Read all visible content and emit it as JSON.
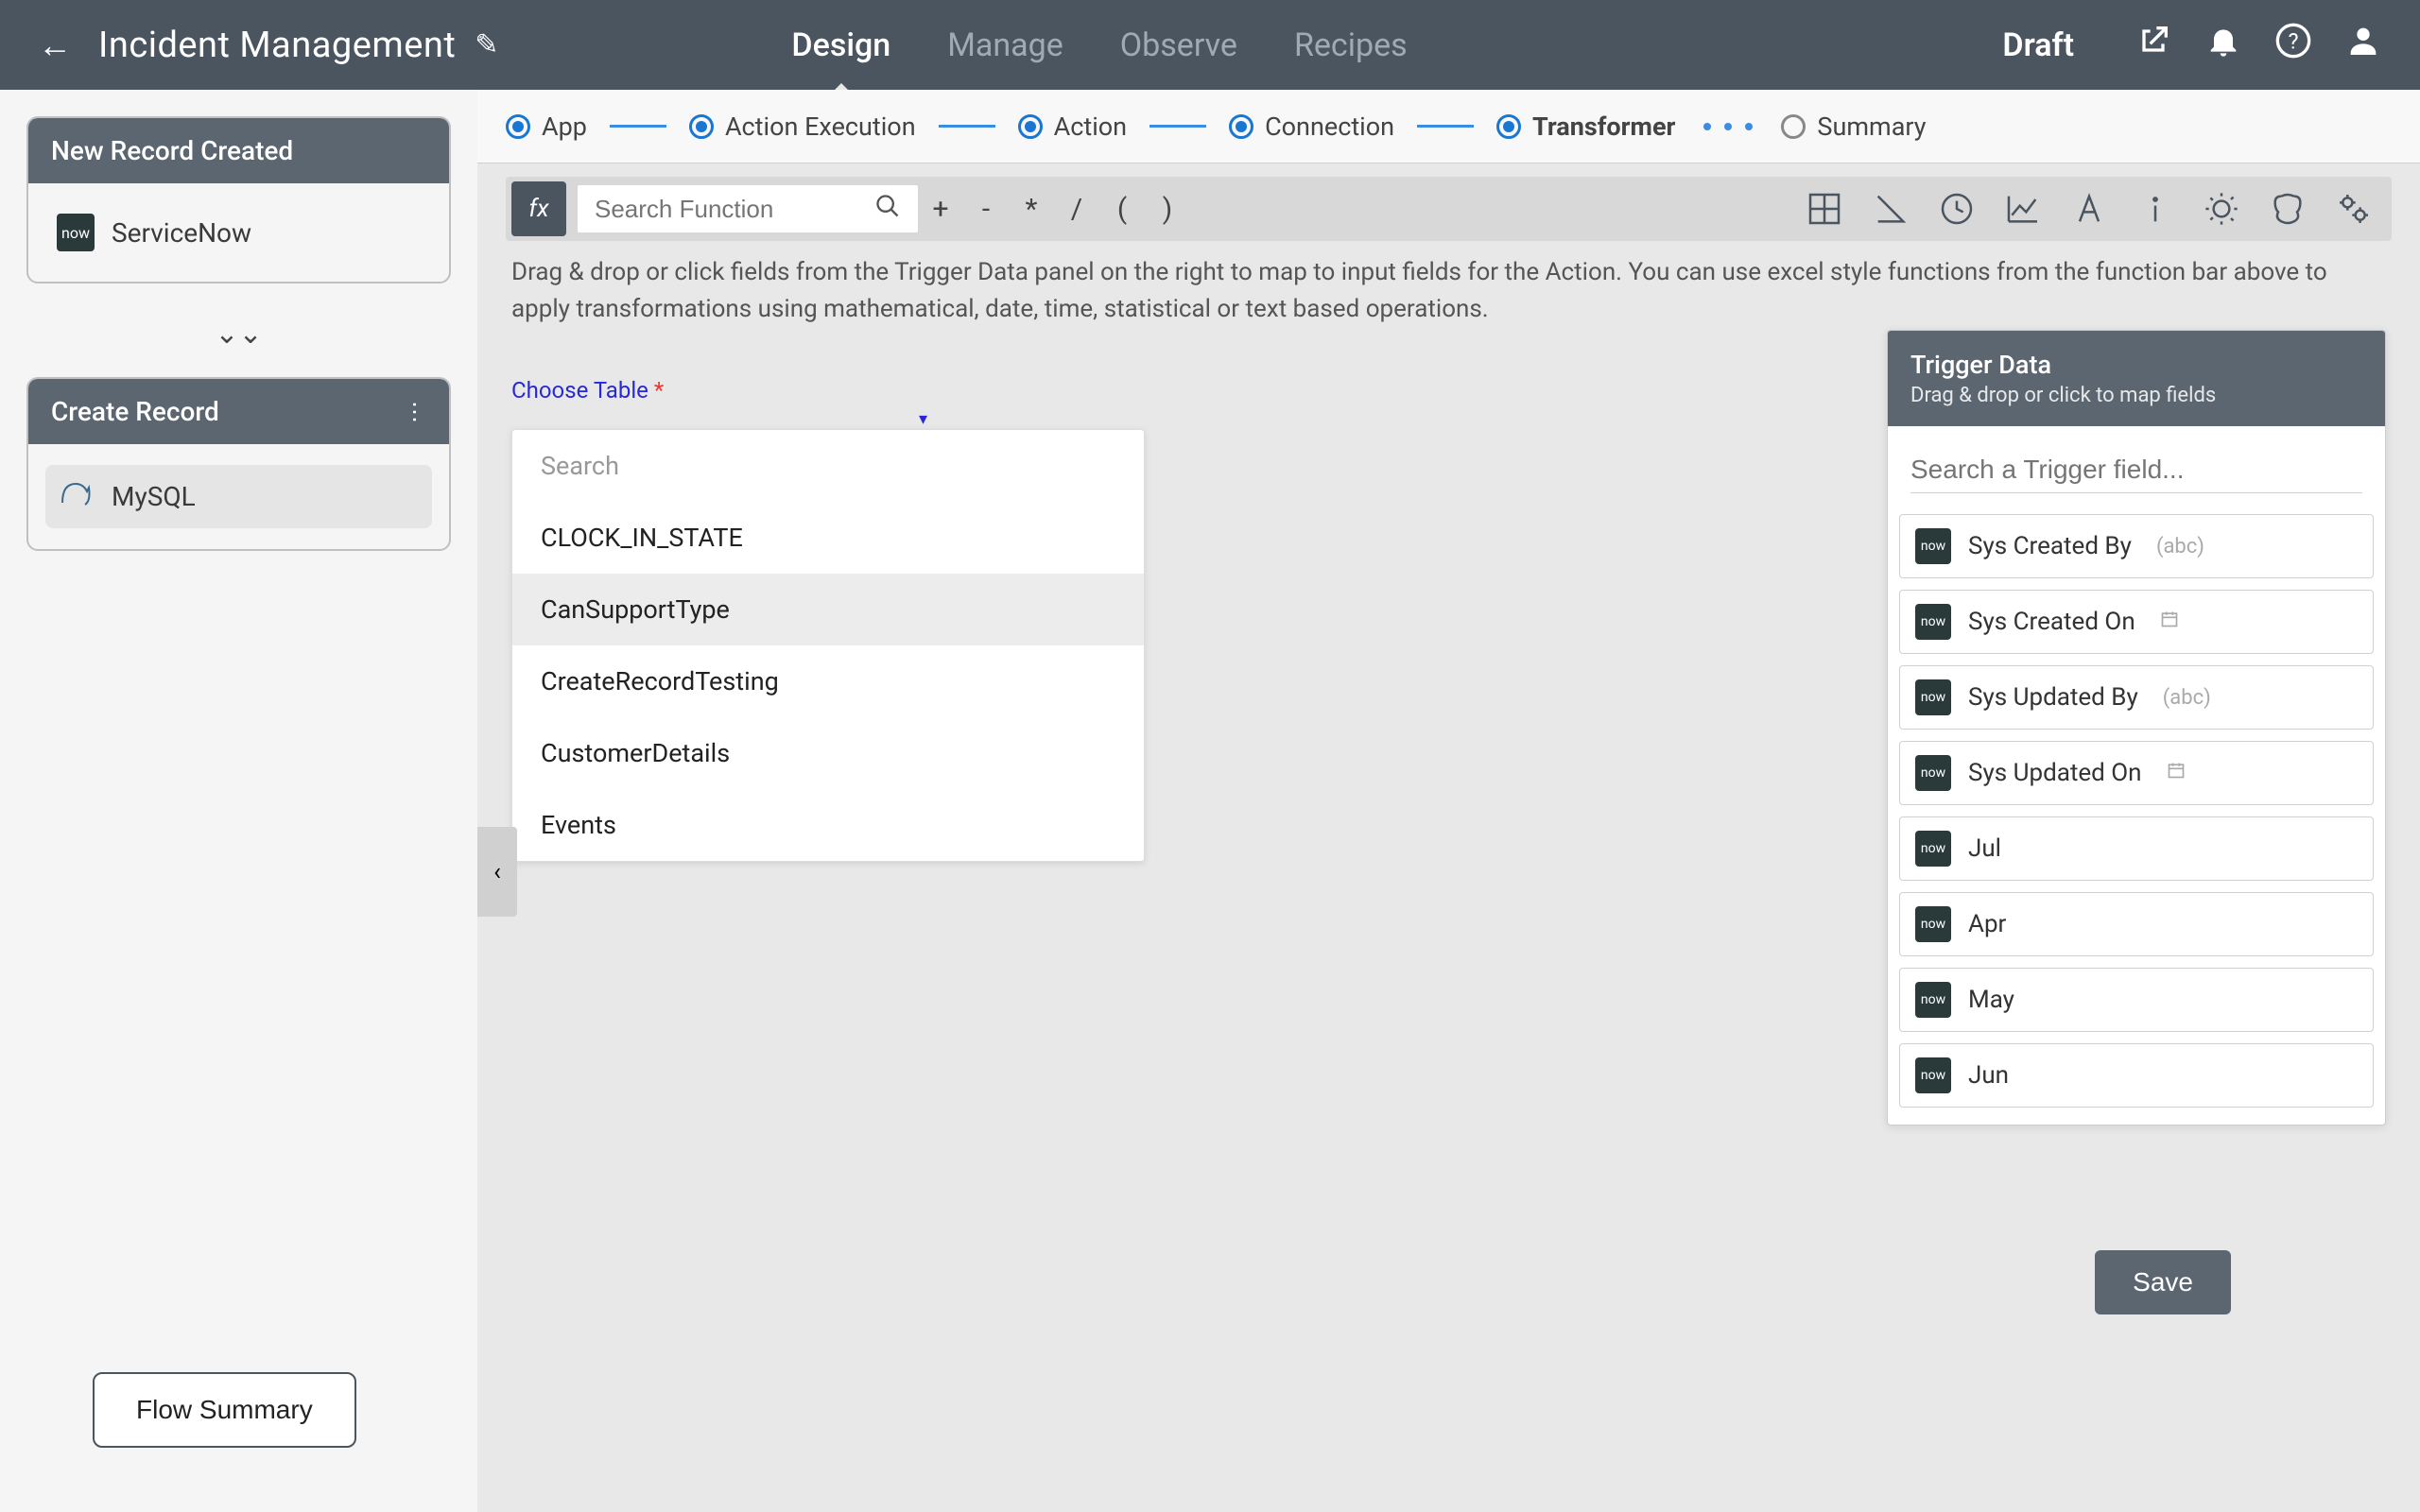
{
  "header": {
    "title": "Incident Management",
    "tabs": [
      "Design",
      "Manage",
      "Observe",
      "Recipes"
    ],
    "activeTab": "Design",
    "status": "Draft"
  },
  "sidebar": {
    "card1": {
      "title": "New Record Created",
      "connector": "ServiceNow",
      "connectorIconText": "now"
    },
    "card2": {
      "title": "Create Record",
      "connector": "MySQL"
    },
    "flowSummaryLabel": "Flow Summary"
  },
  "steps": {
    "items": [
      "App",
      "Action Execution",
      "Action",
      "Connection",
      "Transformer",
      "Summary"
    ],
    "activeIndex": 4
  },
  "functionBar": {
    "fxLabel": "fx",
    "searchPlaceholder": "Search Function",
    "operators": [
      "+",
      "-",
      "*",
      "/",
      "(",
      ")"
    ]
  },
  "instructions": "Drag & drop or click fields from the Trigger Data panel on the right to map to input fields for the Action. You can use excel style functions from the function bar above to apply transformations using mathematical, date, time, statistical or text based operations.",
  "chooseTable": {
    "label": "Choose Table",
    "searchPlaceholder": "Search",
    "options": [
      "CLOCK_IN_STATE",
      "CanSupportType",
      "CreateRecordTesting",
      "CustomerDetails",
      "Events"
    ],
    "hoverIndex": 1
  },
  "triggerPanel": {
    "title": "Trigger Data",
    "subtitle": "Drag & drop or click to map fields",
    "searchPlaceholder": "Search a Trigger field...",
    "iconText": "now",
    "fields": [
      {
        "label": "Sys Created By",
        "type": "(abc)"
      },
      {
        "label": "Sys Created On",
        "type": "date"
      },
      {
        "label": "Sys Updated By",
        "type": "(abc)"
      },
      {
        "label": "Sys Updated On",
        "type": "date"
      },
      {
        "label": "Jul",
        "type": ""
      },
      {
        "label": "Apr",
        "type": ""
      },
      {
        "label": "May",
        "type": ""
      },
      {
        "label": "Jun",
        "type": ""
      }
    ]
  },
  "saveLabel": "Save"
}
